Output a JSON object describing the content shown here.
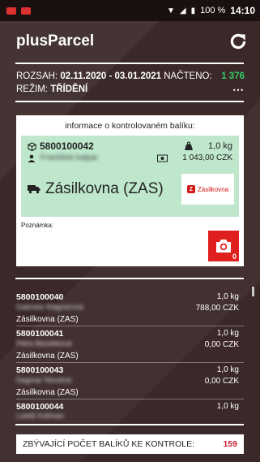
{
  "status_bar": {
    "battery": "100 %",
    "time": "14:10"
  },
  "header": {
    "title": "plusParcel",
    "refresh_icon": "refresh-icon"
  },
  "info": {
    "range_label": "ROZSAH:",
    "range_value": "02.11.2020 - 03.01.2021",
    "loaded_label": "NAČTENO:",
    "loaded_value": "1 376",
    "mode_label": "REŽIM:",
    "mode_value": "TŘÍDĚNÍ",
    "more_icon": "⋯"
  },
  "card": {
    "title": "informace o kontrolovaném balíku:",
    "package_id": "5800100042",
    "recipient": "František kalpar",
    "weight": "1,0 kg",
    "price": "1 043,00 CZK",
    "carrier": "Zásilkovna (ZAS)",
    "carrier_logo_text": "Zásilkovna",
    "note_label": "Poznámka:",
    "photo_count": "0"
  },
  "packages": [
    {
      "id": "5800100040",
      "name": "Gabriela Wágnerová",
      "carrier": "Zásilkovna (ZAS)",
      "weight": "1,0 kg",
      "price": "788,00 CZK"
    },
    {
      "id": "5800100041",
      "name": "Petra Bezdeková",
      "carrier": "Zásilkovna (ZAS)",
      "weight": "1,0 kg",
      "price": "0,00 CZK"
    },
    {
      "id": "5800100043",
      "name": "Dagmar Novotná",
      "carrier": "Zásilkovna (ZAS)",
      "weight": "1,0 kg",
      "price": "0,00 CZK"
    },
    {
      "id": "5800100044",
      "name": "Lukáš Kollman",
      "carrier": "",
      "weight": "1,0 kg",
      "price": ""
    }
  ],
  "remaining": {
    "label": "ZBÝVAJÍCÍ POČET BALÍKŮ KE KONTROLE:",
    "value": "159"
  },
  "colors": {
    "accent_red": "#e01f1f",
    "green": "#33cc66",
    "card_green": "#bfe7cc"
  }
}
